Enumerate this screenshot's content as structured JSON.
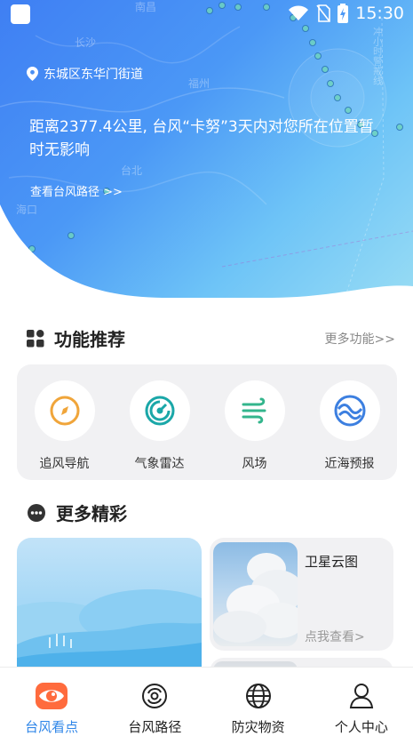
{
  "status_bar": {
    "time": "15:30",
    "icons": [
      "app-icon",
      "wifi-icon",
      "no-sim-icon",
      "battery-charging-icon"
    ]
  },
  "hero": {
    "location": "东城区东华门街道",
    "location_icon": "location-pin-icon",
    "message": "距离2377.4公里, 台风“卡努”3天内对您所在位置暂时无影响",
    "track_link": "查看台风路径 >>",
    "map_labels": [
      "南昌",
      "长沙",
      "福州",
      "台北",
      "海口",
      "冲小时警戒线"
    ],
    "colors": {
      "gradient_start": "#3f7ff3",
      "gradient_end": "#98dcf4"
    }
  },
  "functions": {
    "title": "功能推荐",
    "title_icon": "grid-icon",
    "more": "更多功能>>",
    "items": [
      {
        "label": "追风导航",
        "icon": "compass-icon",
        "color": "#f0a53a"
      },
      {
        "label": "气象雷达",
        "icon": "radar-icon",
        "color": "#1aa7a8"
      },
      {
        "label": "风场",
        "icon": "wind-icon",
        "color": "#33b58c"
      },
      {
        "label": "近海预报",
        "icon": "wave-icon",
        "color": "#3c7fe0"
      }
    ]
  },
  "more_section": {
    "title": "更多精彩",
    "title_icon": "more-dots-icon",
    "cards": [
      {
        "title": "卫星云图",
        "link": "点我查看>"
      }
    ]
  },
  "bottom_nav": {
    "active_color": "#2f86e8",
    "items": [
      {
        "label": "台风看点",
        "icon": "eye-icon",
        "active": true
      },
      {
        "label": "台风路径",
        "icon": "typhoon-icon",
        "active": false
      },
      {
        "label": "防灾物资",
        "icon": "globe-icon",
        "active": false
      },
      {
        "label": "个人中心",
        "icon": "person-icon",
        "active": false
      }
    ]
  }
}
